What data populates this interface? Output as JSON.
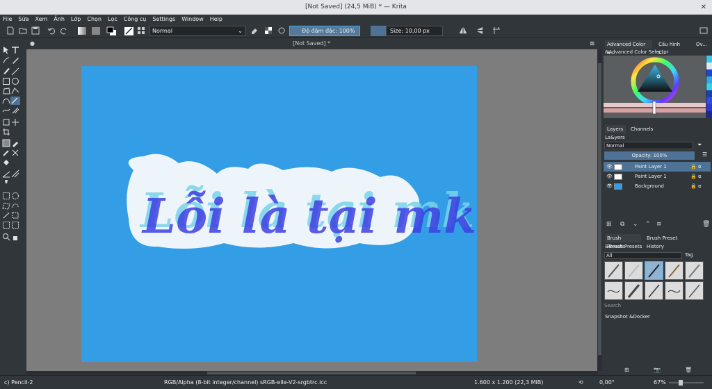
{
  "window": {
    "title": "[Not Saved]  (24,5 MiB)  * — Krita",
    "close_glyph": "✕"
  },
  "menu": [
    "File",
    "Sửa",
    "Xem",
    "Ảnh",
    "Lớp",
    "Chọn",
    "Lọc",
    "Công cụ",
    "Settings",
    "Window",
    "Help"
  ],
  "toolbar": {
    "blend_mode": "Normal",
    "opacity_label": "Độ đậm đặc: 100%",
    "size_label": "Size: 10,00 px"
  },
  "document": {
    "tab_title": "[Not Saved]  *",
    "canvas_color": "#339ee6",
    "text": "Lỗi là tại mk"
  },
  "dockers": {
    "tabs_top": [
      "Advanced Color S...",
      "Cấu hình C...",
      "Ov..."
    ],
    "color_selector_title": "&Advanced Color Selector",
    "layers_tabs": [
      "Layers",
      "Channels"
    ],
    "layers_title": "La&yers",
    "layer_blend": "Normal",
    "layer_opacity": "Opacity:  100%",
    "layers": [
      {
        "name": "Paint Layer 1",
        "selected": true
      },
      {
        "name": "Paint Layer 1",
        "selected": false
      },
      {
        "name": "Background",
        "selected": false
      }
    ],
    "brush_tabs": [
      "Brush Presets",
      "Brush Preset History"
    ],
    "brush_title": "&Brush Presets",
    "brush_filter": "All",
    "brush_tag": "Tag",
    "search_placeholder": "Search",
    "snapshot_title": "Snapshot &Docker"
  },
  "status": {
    "brush": "c) Pencil-2",
    "color_space": "RGB/Alpha (8-bit integer/channel)  sRGB-elle-V2-srgbtrc.icc",
    "image_size": "1.600 x 1.200 (22,3 MiB)",
    "rotation": "0,00°",
    "zoom": "67%"
  },
  "colors": {
    "accent": "#3daee9",
    "selected_layer": "#4f7396",
    "panel": "#31363b"
  }
}
